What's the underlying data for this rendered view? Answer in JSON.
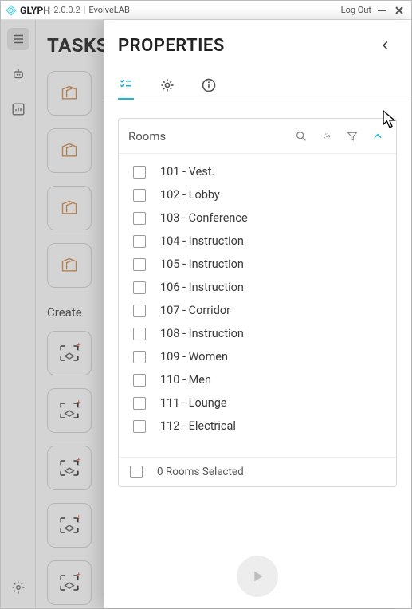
{
  "titlebar": {
    "app_name": "GLYPH",
    "version": "2.0.0.2",
    "company": "EvolveLAB",
    "logout": "Log Out"
  },
  "tasks": {
    "title": "TASKS",
    "create_label": "Create"
  },
  "panel": {
    "title": "PROPERTIES",
    "section_title": "Rooms",
    "items": [
      "101 - Vest.",
      "102 - Lobby",
      "103 - Conference",
      "104 - Instruction",
      "105 - Instruction",
      "106 - Instruction",
      "107 - Corridor",
      "108 - Instruction",
      "109 - Women",
      "110 - Men",
      "111 - Lounge",
      "112 - Electrical"
    ],
    "footer": "0 Rooms Selected"
  }
}
